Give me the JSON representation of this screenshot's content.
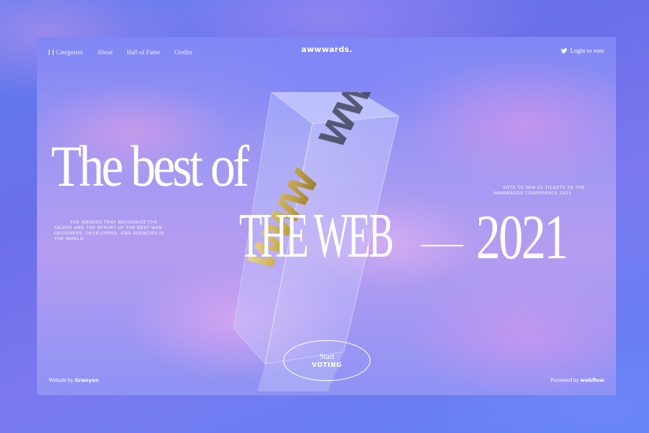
{
  "nav": {
    "items": [
      {
        "label": "Categories",
        "icon": "grid-icon"
      },
      {
        "label": "About"
      },
      {
        "label": "Hall of Fame"
      },
      {
        "label": "Credits"
      }
    ],
    "logo": "awwwards.",
    "login_label": "Login to vote",
    "login_icon": "twitter-bird-icon"
  },
  "hero": {
    "line1": "The best of",
    "line2": "THE WEB",
    "year": "2021",
    "description_left": "The awards that recognize the talent and the effort of the best web designers, developers, and agencies in the world.",
    "description_right": "Vote to win 2x tickets to the Awwwards Conference 2022",
    "trophy_text": "WWW"
  },
  "cta": {
    "line1": "Start",
    "line2": "VOTING"
  },
  "footer": {
    "left_prefix": "Website by",
    "left_name": "Granyon",
    "right_prefix": "Presented by",
    "right_name": "webflow"
  },
  "colors": {
    "background": "#6b6fe8",
    "text": "#ffffff",
    "trophy_gold": "#c9a94a"
  }
}
